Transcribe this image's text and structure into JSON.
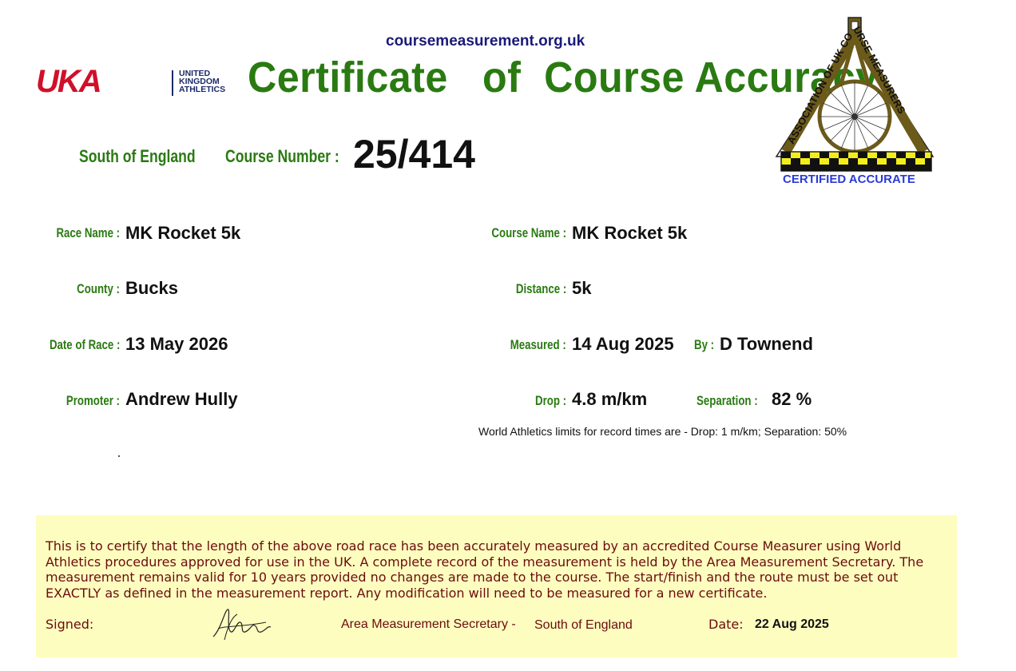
{
  "header": {
    "site_url": "coursemeasurement.org.uk",
    "title": "Certificate   of  Course Accuracy",
    "uka_logo": {
      "letters": "UKA",
      "line1": "UNITED",
      "line2": "KINGDOM",
      "line3": "ATHLETICS"
    },
    "acm_logo": {
      "ring_text": "ASSOCIATION OF UK COURSE MEASURERS",
      "badge": "CERTIFIED ACCURATE"
    }
  },
  "course": {
    "area": "South of England",
    "number_label": "Course Number :",
    "number": "25/414"
  },
  "fields": {
    "race_name_label": "Race Name :",
    "race_name": "MK Rocket 5k",
    "course_name_label": "Course Name :",
    "course_name": "MK Rocket 5k",
    "county_label": "County :",
    "county": "Bucks",
    "distance_label": "Distance :",
    "distance": "5k",
    "date_label": "Date of Race :",
    "date": "13 May 2026",
    "measured_label": "Measured :",
    "measured": "14 Aug 2025",
    "by_label": "By :",
    "by": "D Townend",
    "promoter_label": "Promoter :",
    "promoter": "Andrew Hully",
    "drop_label": "Drop :",
    "drop": "4.8 m/km",
    "separation_label": "Separation :",
    "separation": "82 %"
  },
  "note": "World Athletics limits for record times are - Drop: 1 m/km; Separation: 50%",
  "certification": {
    "text": "This is to certify that the length of the above road race has been accurately measured by an accredited Course Measurer using World Athletics procedures approved for use in the UK. A complete record of the measurement is held by the Area Measurement Secretary. The measurement remains valid for 10 years provided no changes are made to the course. The start/finish and the route must be set out EXACTLY as defined in the measurement report. Any modification will need to be measured for a new certificate.",
    "signed_label": "Signed:",
    "secretary_label": "Area Measurement Secretary -",
    "secretary_area": "South of England",
    "date_label": "Date:",
    "date": "22 Aug 2025"
  },
  "colors": {
    "title_green": "#2a7a12",
    "uka_red": "#d0102a",
    "uka_navy": "#1b2a6b",
    "box_yellow": "#fdfdc0",
    "box_text": "#6b0c0c",
    "badge_blue": "#2a3bd6"
  }
}
